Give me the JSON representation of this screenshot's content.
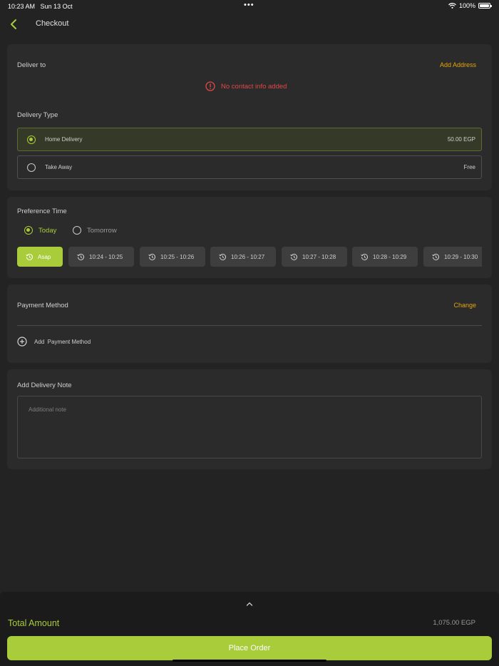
{
  "status_bar": {
    "time": "10:23 AM",
    "date": "Sun 13 Oct",
    "battery": "100%"
  },
  "header": {
    "title": "Checkout"
  },
  "deliver_to": {
    "label": "Deliver to",
    "add_address": "Add Address",
    "warning": "No contact info added",
    "delivery_type_label": "Delivery Type",
    "options": [
      {
        "label": "Home Delivery",
        "price": "50.00 EGP",
        "selected": true
      },
      {
        "label": "Take Away",
        "price": "Free",
        "selected": false
      }
    ]
  },
  "preference": {
    "label": "Preference Time",
    "days": [
      {
        "label": "Today",
        "selected": true
      },
      {
        "label": "Tomorrow",
        "selected": false
      }
    ],
    "slots": [
      {
        "label": "Asap",
        "active": true
      },
      {
        "label": "10:24 - 10:25",
        "active": false
      },
      {
        "label": "10:25 - 10:26",
        "active": false
      },
      {
        "label": "10:26 - 10:27",
        "active": false
      },
      {
        "label": "10:27 - 10:28",
        "active": false
      },
      {
        "label": "10:28 - 10:29",
        "active": false
      },
      {
        "label": "10:29 - 10:30",
        "active": false
      }
    ]
  },
  "payment": {
    "label": "Payment Method",
    "change": "Change",
    "add": "Add  Payment Method"
  },
  "note": {
    "label": "Add Delivery Note",
    "placeholder": "Additional note"
  },
  "footer": {
    "total_label": "Total Amount",
    "total_value": "1,075.00 EGP",
    "place_order": "Place Order"
  },
  "colors": {
    "accent": "#a8cc3a",
    "link": "#e5a50a",
    "error": "#e04848",
    "background": "#232323",
    "card": "#2b2b2b"
  },
  "icons": [
    "chevron-left-icon",
    "info-icon",
    "clock-icon",
    "plus-circle-icon",
    "chevron-up-icon",
    "wifi-icon",
    "battery-icon"
  ]
}
